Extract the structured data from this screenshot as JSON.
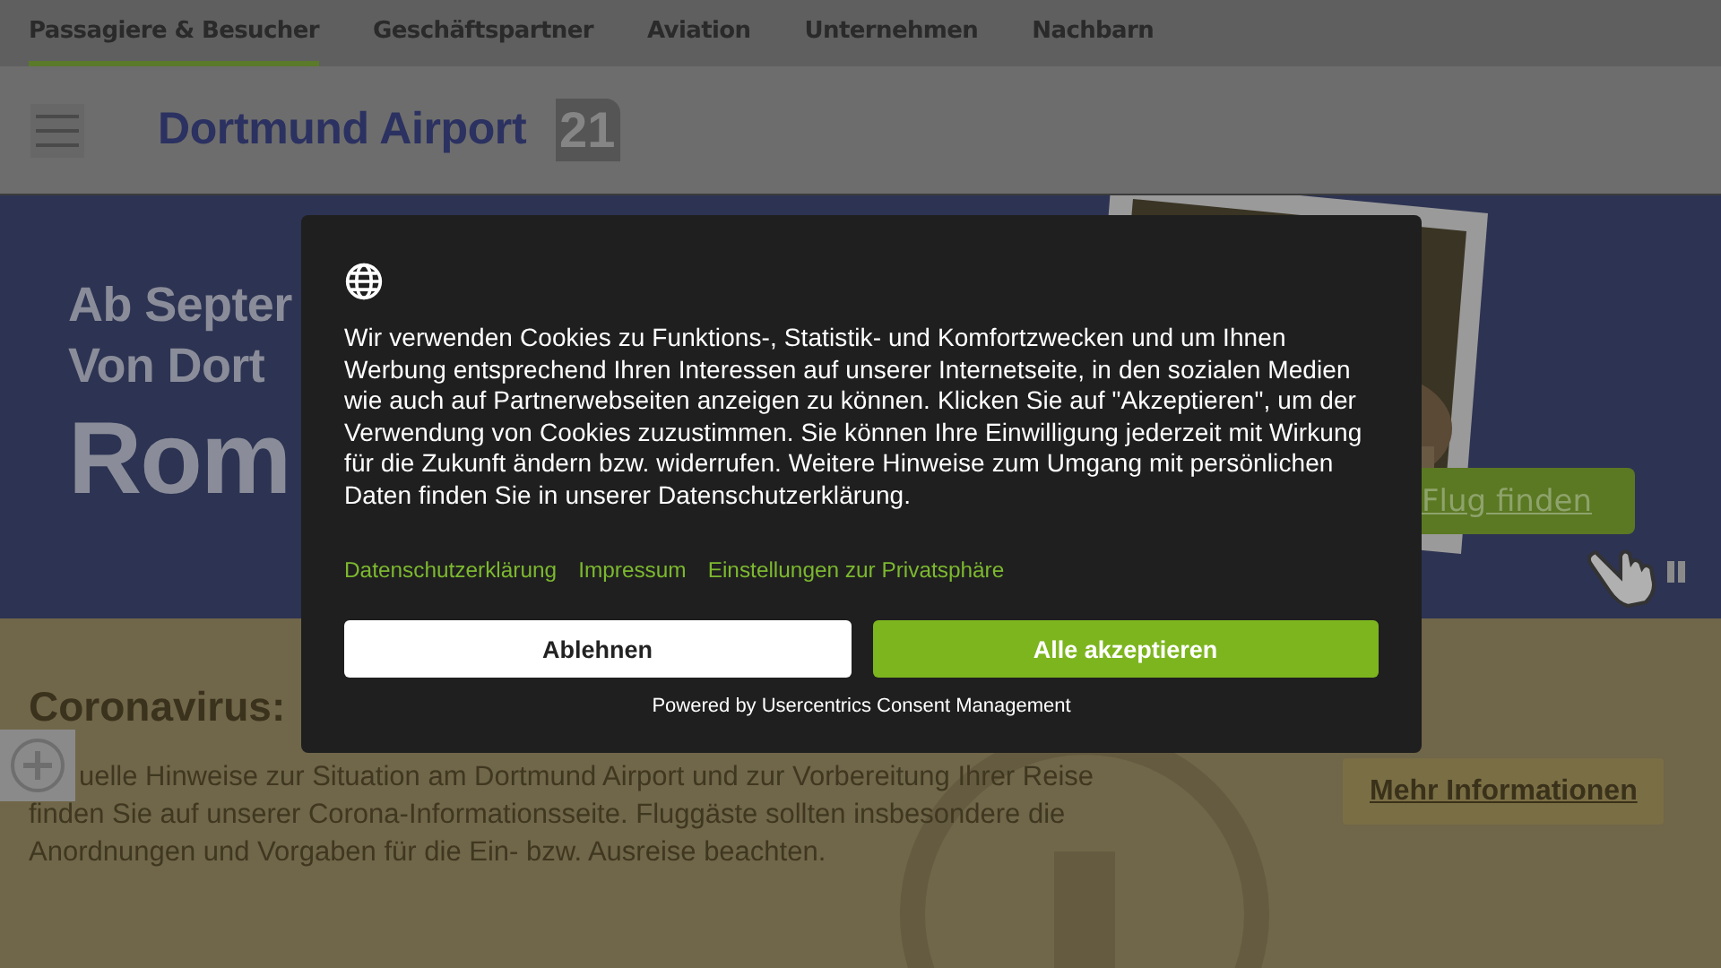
{
  "top_nav": {
    "tabs": [
      {
        "label": "Passagiere & Besucher",
        "selected": true
      },
      {
        "label": "Geschäftspartner",
        "selected": false
      },
      {
        "label": "Aviation",
        "selected": false
      },
      {
        "label": "Unternehmen",
        "selected": false
      },
      {
        "label": "Nachbarn",
        "selected": false
      }
    ]
  },
  "header": {
    "logo_text": "Dortmund Airport",
    "logo_badge": "21"
  },
  "hero": {
    "lines": [
      "Ab Septer",
      "Von Dort",
      "Rom"
    ],
    "button": "Flug finden"
  },
  "notice": {
    "title": "Coronavirus:",
    "text": "uelle Hinweise zur Situation am Dortmund Airport und zur Vorbereitung Ihrer Reise finden Sie auf unserer Corona-Informationsseite. Fluggäste sollten insbesondere die Anordnungen und Vorgaben für die Ein- bzw. Ausreise beachten.",
    "button": "Mehr Informationen"
  },
  "consent": {
    "text": "Wir verwenden Cookies zu Funktions-, Statistik- und Komfortzwecken und um Ihnen Werbung entsprechend Ihren Interessen auf unserer Internetseite, in den sozialen Medien wie auch auf Partnerwebseiten anzeigen zu können. Klicken Sie auf \"Akzeptieren\", um der Verwendung von Cookies zuzustimmen. Sie können Ihre Einwilligung jederzeit mit Wirkung für die Zukunft ändern bzw. widerrufen. Weitere Hinweise zum Umgang mit persönlichen Daten finden Sie in unserer Datenschutzerklärung.",
    "links": [
      "Datenschutzerklärung",
      "Impressum",
      "Einstellungen zur Privatsphäre"
    ],
    "buttons": [
      {
        "label": "Ablehnen",
        "kind": "deny"
      },
      {
        "label": "Alle akzeptieren",
        "kind": "accept"
      }
    ],
    "footer": "Powered by Usercentrics Consent Management"
  }
}
